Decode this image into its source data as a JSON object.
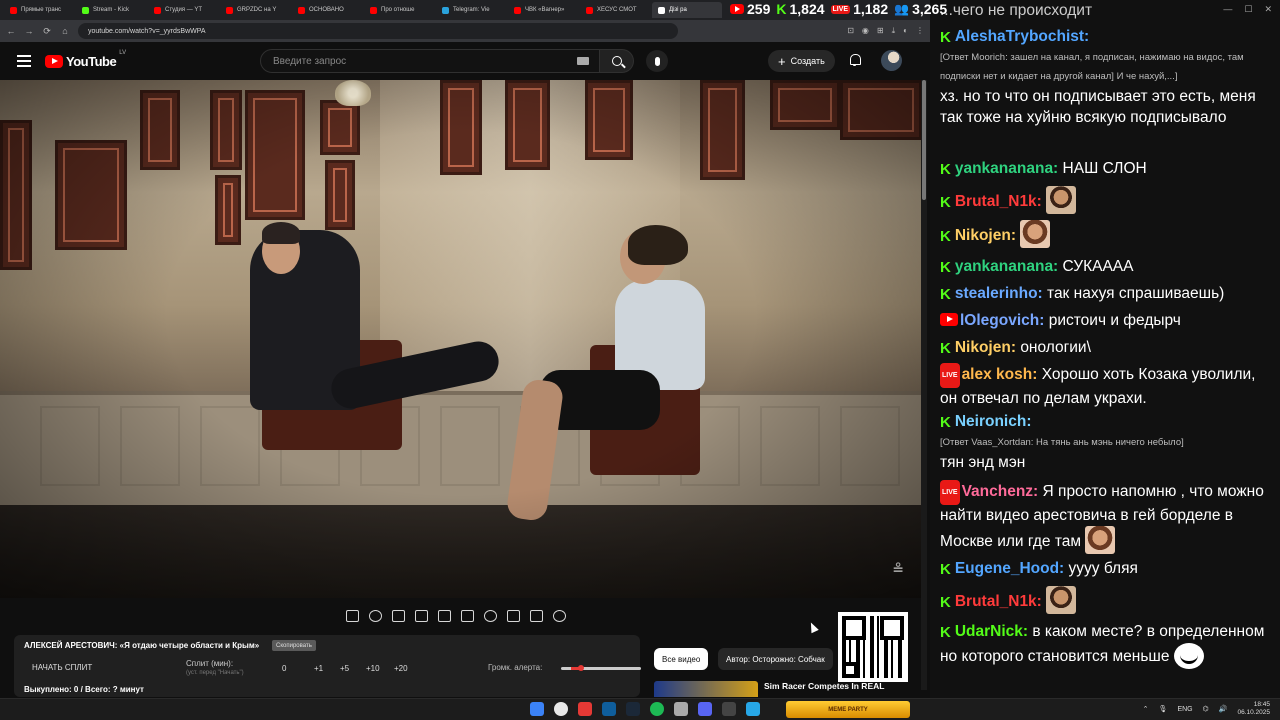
{
  "browser": {
    "tabs": [
      {
        "label": "Прямые транс",
        "color": "#ff0000"
      },
      {
        "label": "Stream - Kick",
        "color": "#53fc18"
      },
      {
        "label": "Студия — YT",
        "color": "#ff0000"
      },
      {
        "label": "GRPZDC на Y",
        "color": "#ff0000"
      },
      {
        "label": "ОСНОВАНО",
        "color": "#ff0000"
      },
      {
        "label": "Про отноше",
        "color": "#ff0000"
      },
      {
        "label": "Telegram: Vie",
        "color": "#2aa3dd"
      },
      {
        "label": "ЧВК «Вагнер»",
        "color": "#ff0000"
      },
      {
        "label": "ХЕСУС СМОТ",
        "color": "#ff0000"
      },
      {
        "label": "Дізі ра",
        "color": "#ffffff"
      }
    ],
    "url": "youtube.com/watch?v=_yyrdsBwWPA",
    "nav": {
      "back": "←",
      "forward": "→",
      "reload": "⟳",
      "home": "⌂"
    }
  },
  "stream_counters": {
    "youtube": "259",
    "kick": "1,824",
    "live": "1,182",
    "viewers": "3,265",
    "live_badge": "LIVE"
  },
  "youtube": {
    "logo": "YouTube",
    "region": "LV",
    "search_placeholder": "Введите запрос",
    "create_label": "Создать",
    "create_plus": "+"
  },
  "video": {
    "watermark": "≗"
  },
  "extension": {
    "title": "АЛЕКСЕЙ АРЕСТОВИЧ: «Я отдаю четыре области и Крым»",
    "small_button": "Скопировать",
    "start_split": "НАЧАТЬ СПЛИТ",
    "split_label": "Сплит (мин):",
    "split_hint": "(уст. перед \"Начать\")",
    "split_values": [
      "0",
      "+1",
      "+5",
      "+10",
      "+20"
    ],
    "volume_label": "Громк. алерта:",
    "volume_level": 0.2,
    "status": "Выкуплено: 0 / Всего: ? минут"
  },
  "recommendations": {
    "chip_all": "Все видео",
    "chip_author": "Автор: Осторожно: Собчак",
    "first_title": "Sim Racer Competes In REAL"
  },
  "chat": {
    "top_fragment": "...чего не происходит",
    "messages": [
      {
        "platform": "kick",
        "user": "AleshaTrybochist:",
        "color": "#53a6ff",
        "reply": "[Ответ Moorich: зашел на канал, я подписан, нажимаю на видос, там подписки нет и кидает на другой канал] И че нахуй,...]",
        "text": "хз. но то что он подписывает это есть, меня так тоже на хуйню всякую подписывало"
      },
      {
        "platform": "kick",
        "user": "yankananana:",
        "color": "#2fd27f",
        "text": "НАШ СЛОН"
      },
      {
        "platform": "kick",
        "user": "Brutal_N1k:",
        "color": "#ff3b3b",
        "text": "",
        "emote": "grin"
      },
      {
        "platform": "kick",
        "user": "Nikojen:",
        "color": "#ffcf66",
        "text": "",
        "emote": "face"
      },
      {
        "platform": "kick",
        "user": "yankananana:",
        "color": "#2fd27f",
        "text": "СУКАААА"
      },
      {
        "platform": "kick",
        "user": "stealerinho:",
        "color": "#6aa9ff",
        "text": "так нахуя спрашиваешь)"
      },
      {
        "platform": "youtube",
        "user": "lOlegovich:",
        "color": "#7aa7ff",
        "text": "ристоич и федырч"
      },
      {
        "platform": "kick",
        "user": "Nikojen:",
        "color": "#ffcf66",
        "text": "онологии\\"
      },
      {
        "platform": "live",
        "user": "alex kosh:",
        "color": "#ffb84d",
        "text": "Хорошо хоть Козака уволили, он отвечал по делам украхи."
      },
      {
        "platform": "kick",
        "user": "Neironich:",
        "color": "#7ad1ff",
        "reply": "[Ответ Vaas_Xortdan: На тянь ань мэнь ничего небыло]",
        "text": "тян энд мэн"
      },
      {
        "platform": "live",
        "user": "Vanchenz:",
        "color": "#ff6b9a",
        "text": "Я просто напомню , что можно найти видео арестовича в гей борделе в Москве или где там",
        "emote": "face"
      },
      {
        "platform": "kick",
        "user": "Eugene_Hood:",
        "color": "#53a6ff",
        "text": "уууу бляя"
      },
      {
        "platform": "kick",
        "user": "Brutal_N1k:",
        "color": "#ff3b3b",
        "text": "",
        "emote": "grin"
      },
      {
        "platform": "kick",
        "user": "UdarNick:",
        "color": "#53fc18",
        "text": "в каком месте? в определенном но которого становится меньше",
        "emote": "troll"
      }
    ]
  },
  "taskbar": {
    "widget_label": "MEME PARTY",
    "lang": "ENG",
    "time": "18:45",
    "date": "06.10.2025"
  }
}
